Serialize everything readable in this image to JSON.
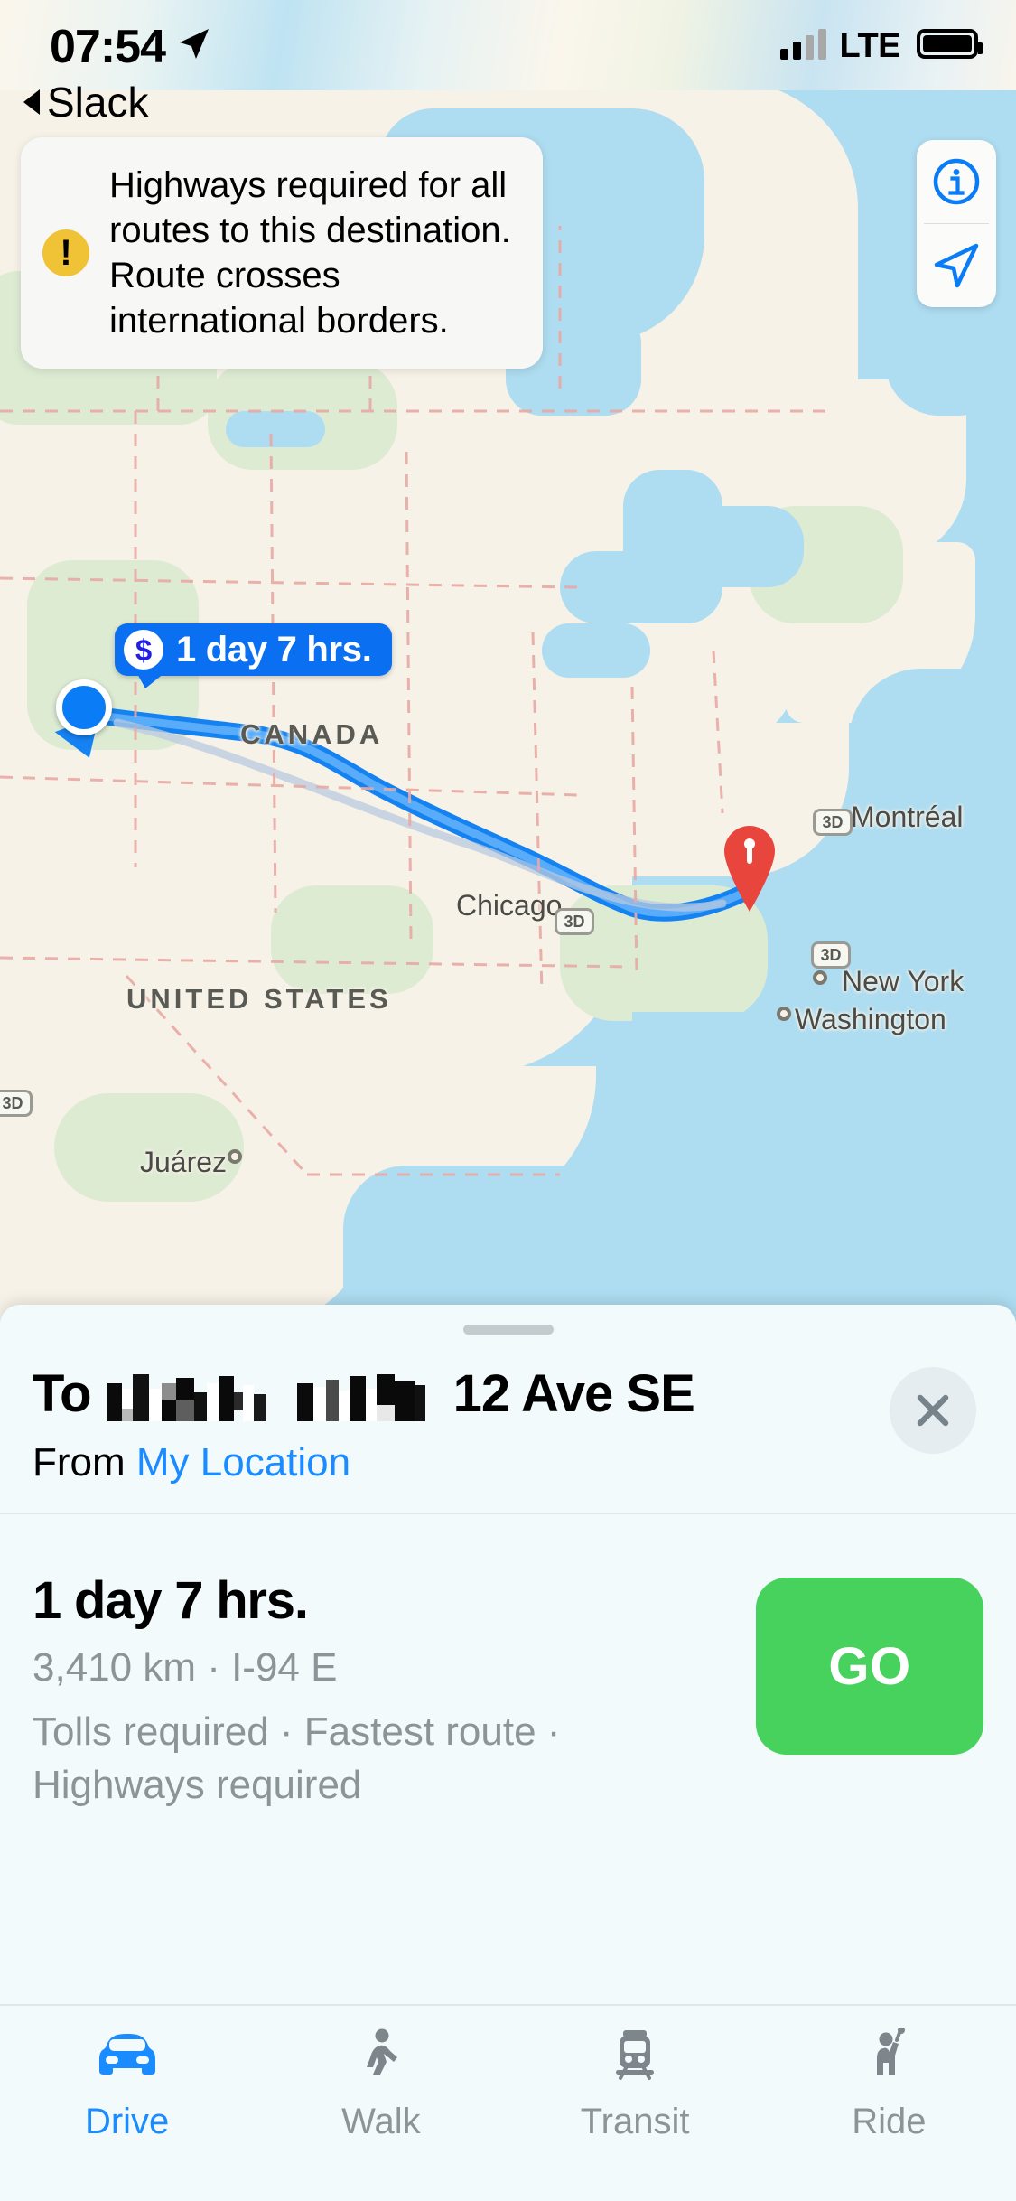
{
  "status_bar": {
    "time": "07:54",
    "location_arrow_icon": "location-arrow-icon",
    "back_app_label": "Slack",
    "carrier_network": "LTE",
    "signal_bars_icon": "signal-bars-icon",
    "battery_icon": "battery-full-icon"
  },
  "alert": {
    "icon": "warning-exclamation-icon",
    "symbol": "!",
    "message": "Highways required for all routes to this destination. Route crosses international borders."
  },
  "map_controls": {
    "info_icon": "info-circle-icon",
    "info_symbol": "i",
    "locate_icon": "navigate-arrow-icon"
  },
  "map": {
    "route_badge": {
      "toll_icon": "dollar-toll-icon",
      "toll_symbol": "$",
      "eta": "1 day 7 hrs."
    },
    "start_marker": "current-location-puck",
    "destination_marker": "destination-pin",
    "labels": [
      {
        "text": "CANADA",
        "type": "country"
      },
      {
        "text": "UNITED STATES",
        "type": "country"
      },
      {
        "text": "Chicago",
        "type": "city"
      },
      {
        "text": "Montréal",
        "type": "city"
      },
      {
        "text": "New York",
        "type": "city"
      },
      {
        "text": "Washington",
        "type": "city"
      },
      {
        "text": "Juárez",
        "type": "city"
      }
    ],
    "road_shields": [
      "3D",
      "3D",
      "3D",
      "3D"
    ]
  },
  "sheet": {
    "grabber": "sheet-grabber",
    "to_label": "To",
    "destination_redacted": true,
    "destination_suffix": "12 Ave SE",
    "from_label": "From",
    "from_value": "My Location",
    "close_icon": "close-x-icon",
    "route": {
      "duration": "1 day 7 hrs.",
      "distance_line": "3,410 km · I-94 E",
      "conditions_line": "Tolls required · Fastest route · Highways required",
      "go_label": "GO"
    },
    "tabs": [
      {
        "label": "Drive",
        "icon": "car-icon",
        "active": true
      },
      {
        "label": "Walk",
        "icon": "walk-icon",
        "active": false
      },
      {
        "label": "Transit",
        "icon": "train-icon",
        "active": false
      },
      {
        "label": "Ride",
        "icon": "hail-ride-icon",
        "active": false
      }
    ]
  },
  "colors": {
    "accent_blue": "#1A8CFF",
    "route_blue": "#0A7CF5",
    "go_green": "#47D25E",
    "warning_yellow": "#F0C235",
    "pin_red": "#E8453C",
    "sheet_bg": "#F2FAFC",
    "muted_text": "#8B9598"
  }
}
